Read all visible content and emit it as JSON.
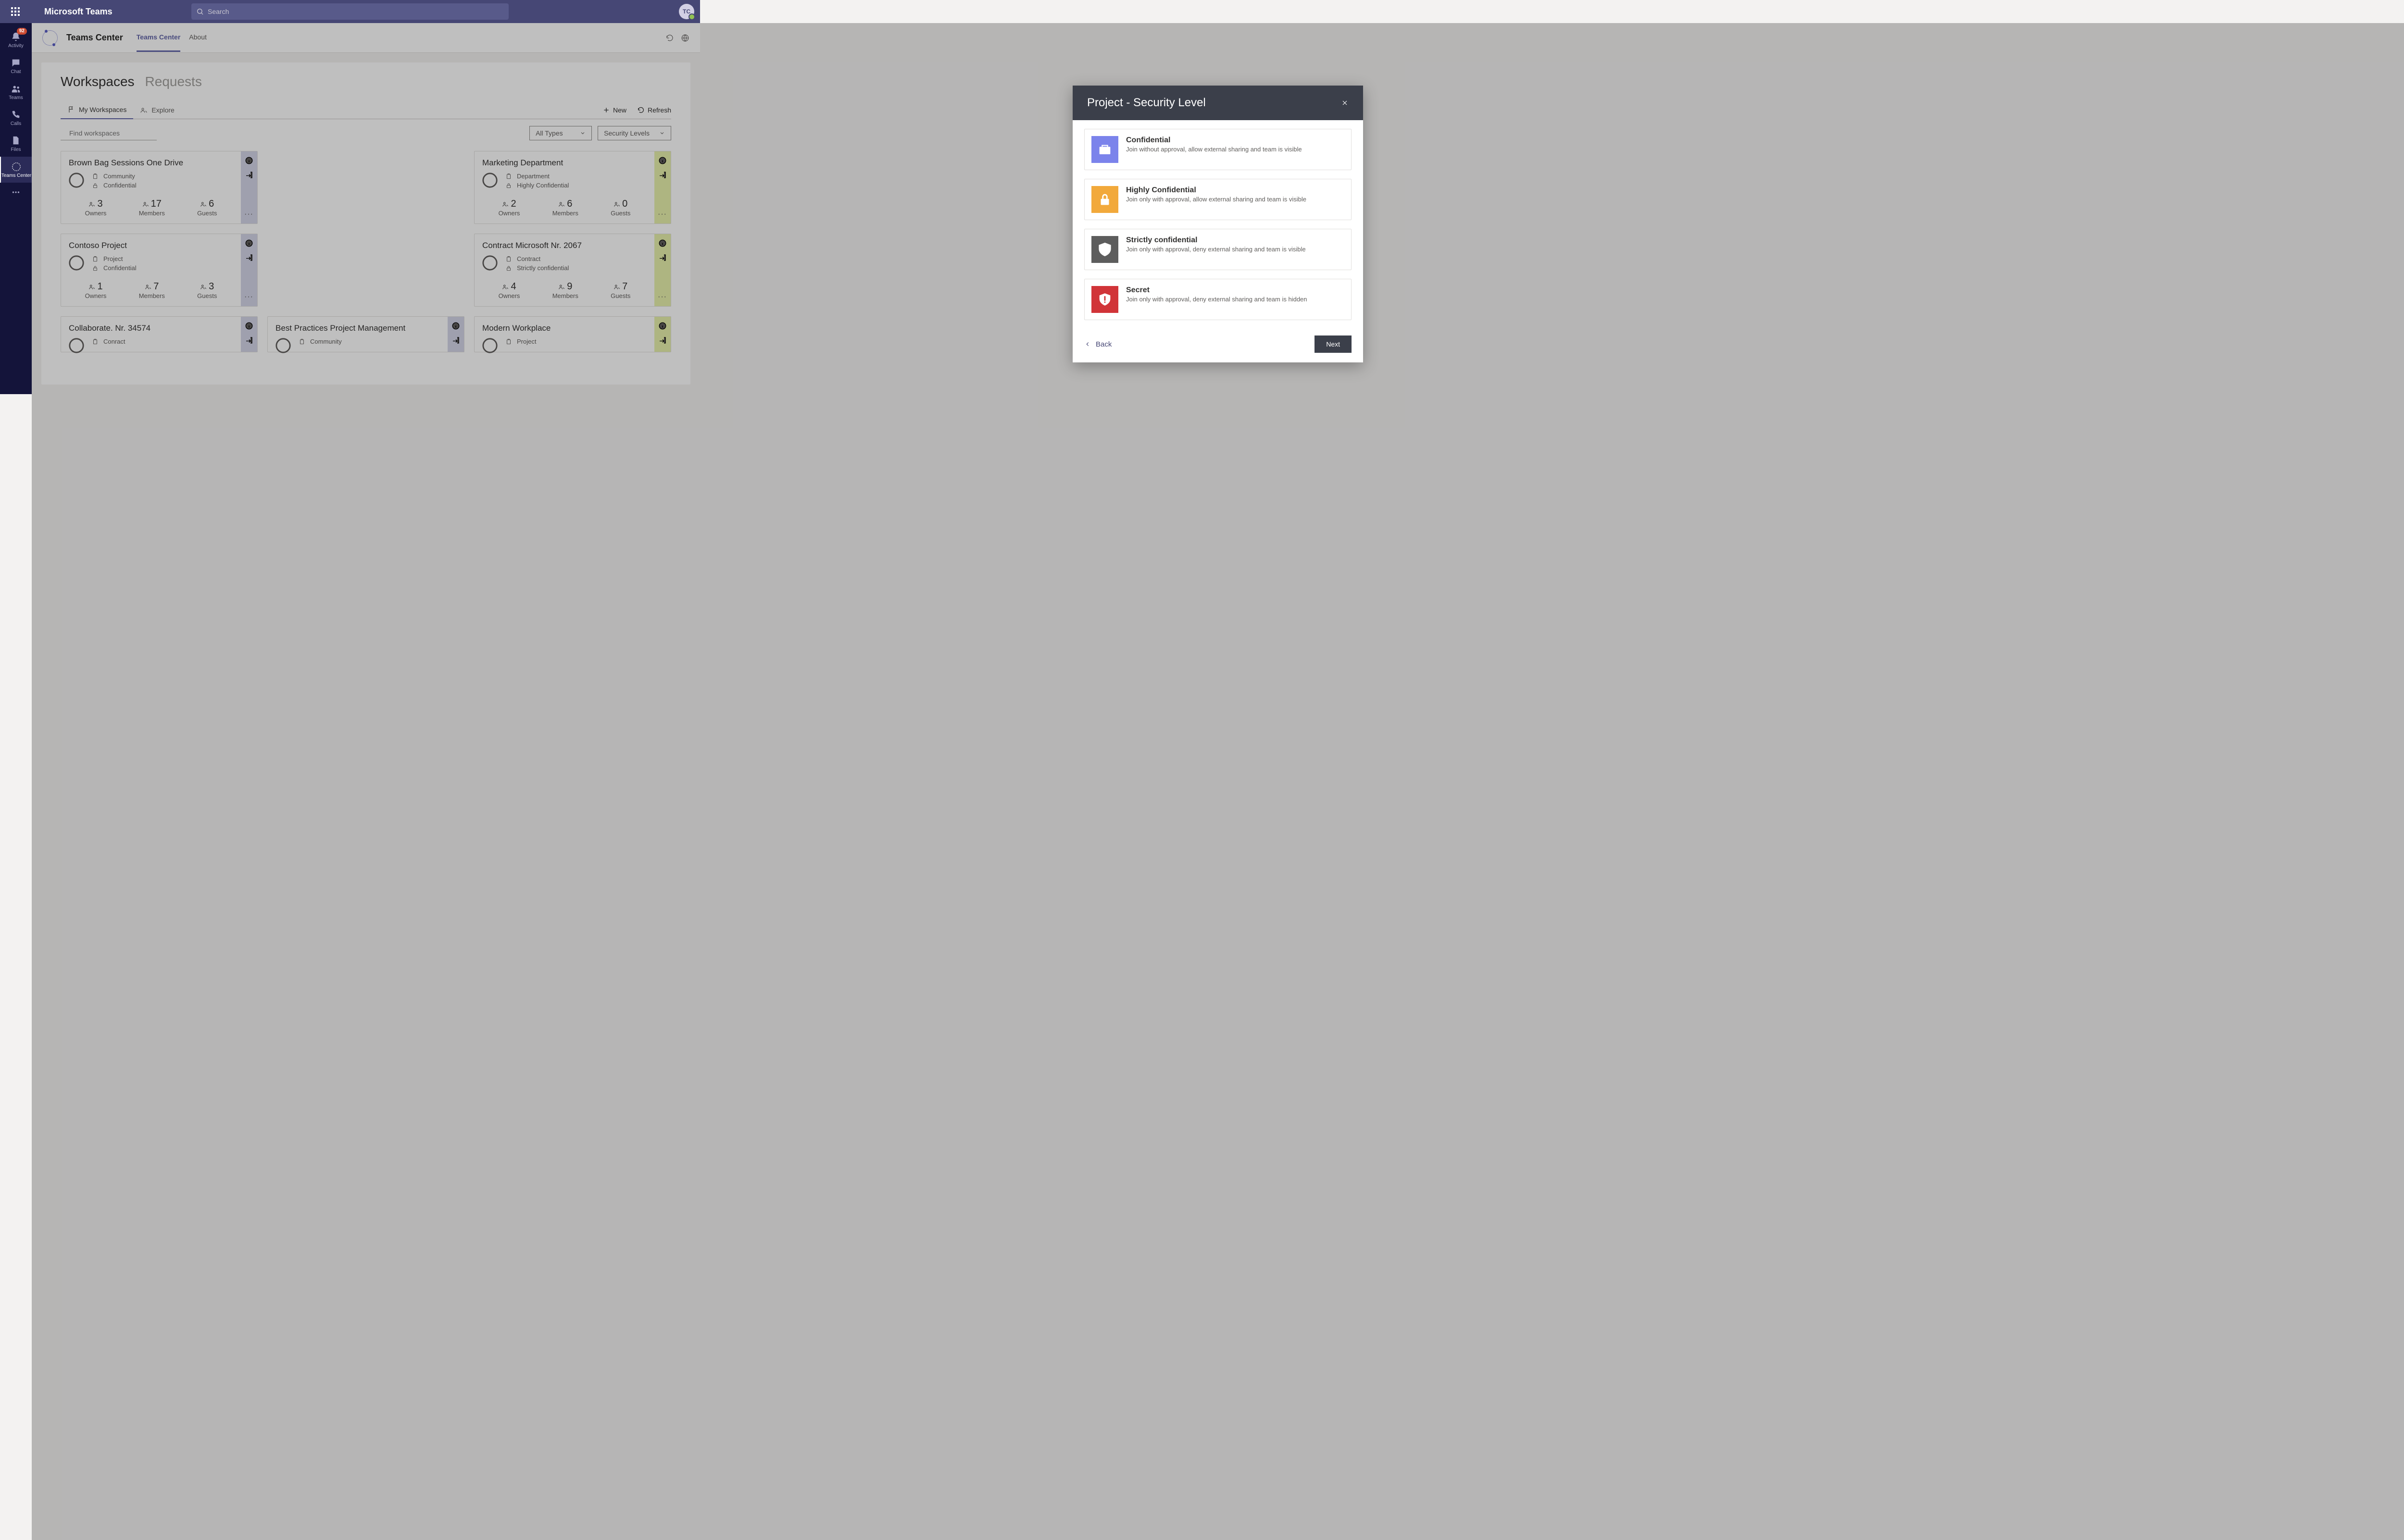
{
  "titlebar": {
    "app": "Microsoft Teams",
    "search_placeholder": "Search",
    "avatar": "TC"
  },
  "leftnav": {
    "badge": "92",
    "items": [
      {
        "label": "Activity"
      },
      {
        "label": "Chat"
      },
      {
        "label": "Teams"
      },
      {
        "label": "Calls"
      },
      {
        "label": "Files"
      },
      {
        "label": "Teams Center"
      }
    ]
  },
  "subheader": {
    "title": "Teams Center",
    "tabs": [
      {
        "label": "Teams Center",
        "active": true
      },
      {
        "label": "About",
        "active": false
      }
    ]
  },
  "page": {
    "heading": "Workspaces",
    "heading2": "Requests",
    "viewtabs": [
      {
        "label": "My Workspaces",
        "active": true
      },
      {
        "label": "Explore",
        "active": false
      }
    ],
    "actions": {
      "new": "New",
      "refresh": "Refresh"
    },
    "filters": {
      "find_placeholder": "Find workspaces",
      "types": "All Types",
      "levels": "Security Levels"
    },
    "stat_labels": {
      "owners": "Owners",
      "members": "Members",
      "guests": "Guests"
    }
  },
  "cards": [
    {
      "title": "Brown Bag Sessions One Drive",
      "type": "Community",
      "level": "Confidential",
      "owners": "3",
      "members": "17",
      "guests": "6",
      "strip": "teal"
    },
    {
      "title": "Marketing Department",
      "type": "Department",
      "level": "Highly Confidential",
      "owners": "2",
      "members": "6",
      "guests": "0",
      "strip": "green"
    },
    {
      "title": "Contoso Project",
      "type": "Project",
      "level": "Confidential",
      "owners": "1",
      "members": "7",
      "guests": "3",
      "strip": "teal"
    },
    {
      "title": "Contract Microsoft Nr. 2067",
      "type": "Contract",
      "level": "Strictly confidential",
      "owners": "4",
      "members": "9",
      "guests": "7",
      "strip": "green"
    },
    {
      "title": "Collaborate. Nr. 34574",
      "type": "Conract",
      "level": "",
      "owners": "",
      "members": "",
      "guests": "",
      "strip": "teal"
    },
    {
      "title": "Best Practices Project Management",
      "type": "Community",
      "level": "",
      "owners": "",
      "members": "",
      "guests": "",
      "strip": "teal"
    },
    {
      "title": "Modern Workplace",
      "type": "Project",
      "level": "",
      "owners": "",
      "members": "",
      "guests": "",
      "strip": "green"
    }
  ],
  "modal": {
    "title": "Project - Security Level",
    "back": "Back",
    "next": "Next",
    "options": [
      {
        "name": "Confidential",
        "desc": "Join without approval, allow external sharing and team is visible",
        "color": "c1"
      },
      {
        "name": "Highly Confidential",
        "desc": "Join only with approval, allow external sharing and team is visible",
        "color": "c2"
      },
      {
        "name": "Strictly confidential",
        "desc": "Join only with approval, deny external sharing and team is visible",
        "color": "c3"
      },
      {
        "name": "Secret",
        "desc": "Join only with approval, deny external sharing and team is hidden",
        "color": "c4"
      }
    ]
  }
}
